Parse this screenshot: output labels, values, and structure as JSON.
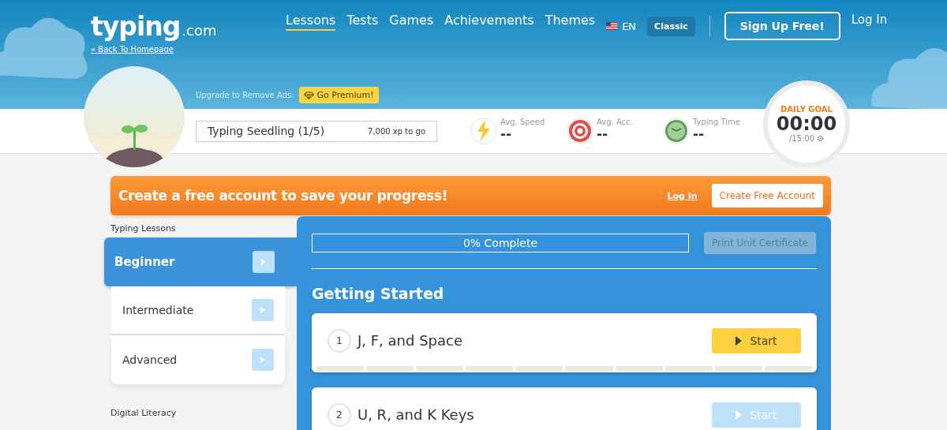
{
  "header": {
    "logo": {
      "name": "typing",
      "suffix": ".com"
    },
    "back_link": "« Back To Homepage",
    "nav": [
      {
        "label": "Lessons",
        "selected": true
      },
      {
        "label": "Tests",
        "selected": false
      },
      {
        "label": "Games",
        "selected": false
      },
      {
        "label": "Achievements",
        "selected": false
      },
      {
        "label": "Themes",
        "selected": false
      }
    ],
    "language": "EN",
    "classic_button": "Classic",
    "signup_button": "Sign Up Free!",
    "login_link": "Log In",
    "upgrade_text": "Upgrade to Remove Ads:",
    "premium_button": "Go Premium!"
  },
  "stats": {
    "rank": "Typing Seedling (1/5)",
    "xp": "7,000 xp to go",
    "items": [
      {
        "kind": "speed",
        "label": "Avg. Speed",
        "value": "--"
      },
      {
        "kind": "accuracy",
        "label": "Avg. Acc.",
        "value": "--"
      },
      {
        "kind": "time",
        "label": "Typing Time",
        "value": "--"
      }
    ],
    "daily_goal": {
      "title": "DAILY GOAL",
      "time": "00:00",
      "target": "/15:00"
    }
  },
  "banner": {
    "text": "Create a free account to save your progress!",
    "login_link": "Log In",
    "create_button": "Create Free Account"
  },
  "sidebar": {
    "heading": "Typing Lessons",
    "items": [
      {
        "label": "Beginner",
        "selected": true
      },
      {
        "label": "Intermediate",
        "selected": false
      },
      {
        "label": "Advanced",
        "selected": false
      }
    ],
    "next_heading": "Digital Literacy"
  },
  "panel": {
    "progress": {
      "label": "0% Complete",
      "level": 0
    },
    "certificate_button": {
      "label": "Print Unit Certificate",
      "disabled": true
    },
    "section_title": "Getting Started",
    "lessons": [
      {
        "number": "1",
        "title": "J, F, and Space",
        "button": "Start",
        "disabled": false
      },
      {
        "number": "2",
        "title": "U, R, and K Keys",
        "button": "Start",
        "disabled": true
      }
    ]
  }
}
